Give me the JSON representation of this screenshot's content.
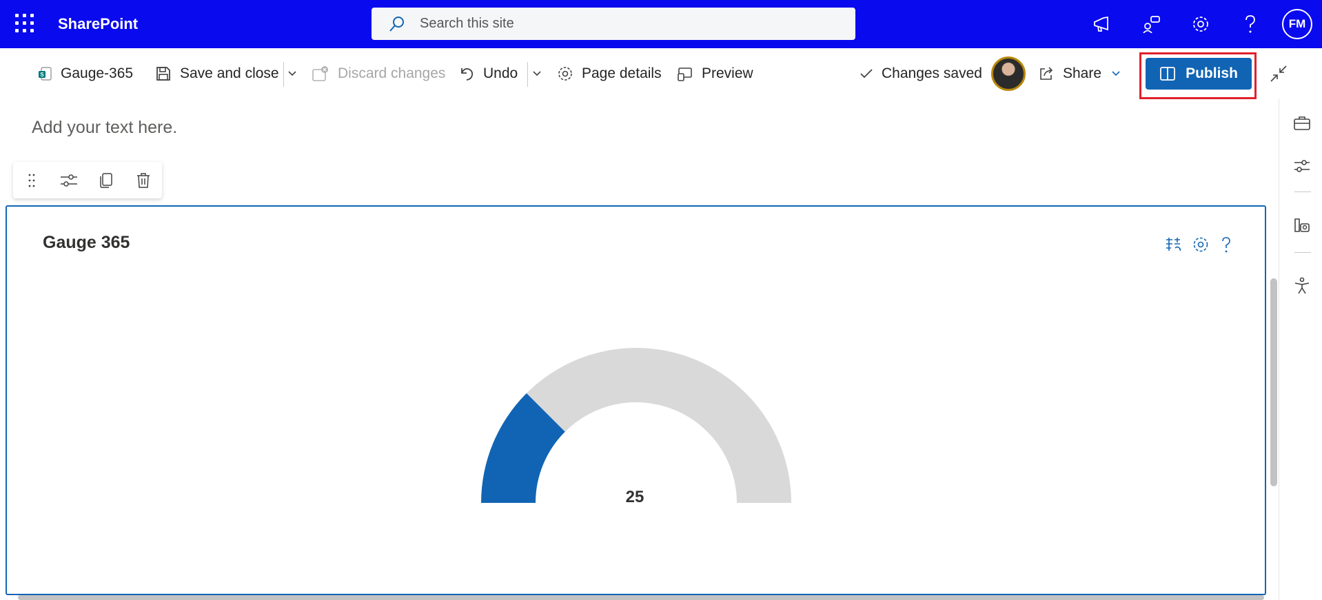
{
  "suite": {
    "app_name": "SharePoint",
    "search_placeholder": "Search this site",
    "user_initials": "FM"
  },
  "commandbar": {
    "page_name": "Gauge-365",
    "save_close": "Save and close",
    "discard": "Discard changes",
    "undo": "Undo",
    "page_details": "Page details",
    "preview": "Preview",
    "status": "Changes saved",
    "share": "Share",
    "publish": "Publish"
  },
  "canvas": {
    "placeholder": "Add your text here."
  },
  "webpart": {
    "title": "Gauge 365",
    "gauge_value": "25"
  },
  "chart_data": {
    "type": "gauge",
    "value": 25,
    "min": 0,
    "max": 100,
    "fill_color": "#1164b4",
    "track_color": "#d9d9d9"
  },
  "colors": {
    "suite_bar": "#0a0aee",
    "accent": "#1164b4",
    "highlight": "#e0202a"
  },
  "icons": {
    "waffle": "app-launcher-icon",
    "megaphone": "megaphone-icon",
    "people": "feedback-icon",
    "settings": "gear-icon",
    "help": "help-icon"
  }
}
